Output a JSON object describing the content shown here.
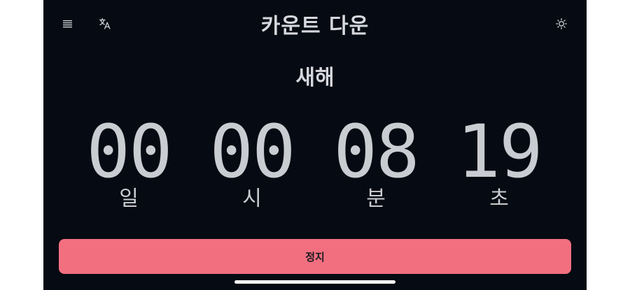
{
  "header": {
    "title": "카운트 다운",
    "menu_icon": "menu-icon",
    "translate_icon": "translate-icon",
    "theme_icon": "sun-icon"
  },
  "event": {
    "name": "새해"
  },
  "countdown": {
    "days": {
      "value": "00",
      "label": "일"
    },
    "hours": {
      "value": "00",
      "label": "시"
    },
    "minutes": {
      "value": "08",
      "label": "분"
    },
    "seconds": {
      "value": "19",
      "label": "초"
    }
  },
  "actions": {
    "stop_label": "정지"
  },
  "colors": {
    "background": "#060a12",
    "text": "#c9ccd1",
    "accent": "#f26f80"
  }
}
